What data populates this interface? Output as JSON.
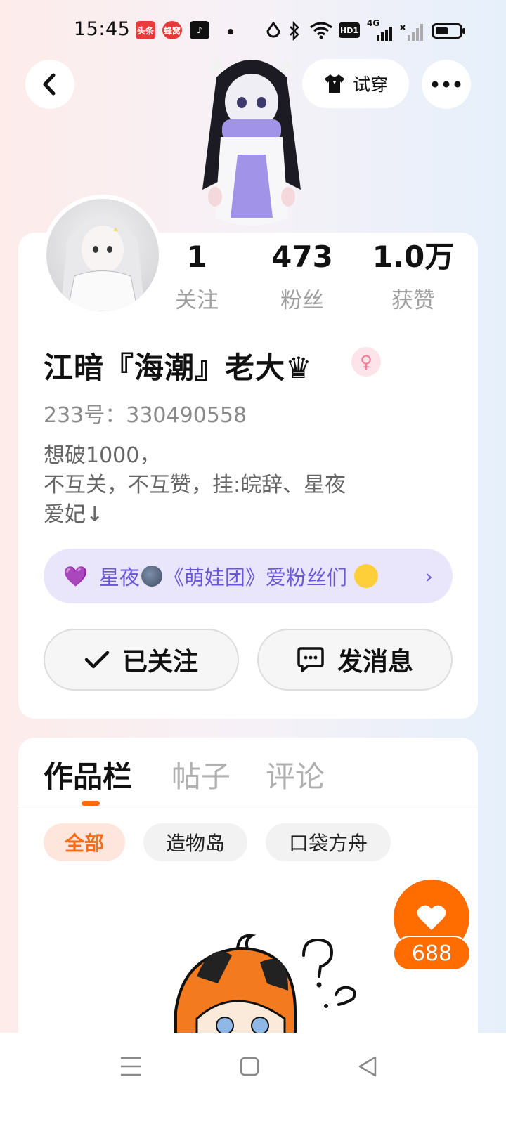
{
  "status_bar": {
    "time": "15:45",
    "app_icons": [
      "头条",
      "蜂窝",
      "♪"
    ],
    "network": "4G",
    "hd": "HD1"
  },
  "header": {
    "try_on_label": "试穿"
  },
  "profile": {
    "stats": [
      {
        "value": "1",
        "label": "关注"
      },
      {
        "value": "473",
        "label": "粉丝"
      },
      {
        "value": "1.0万",
        "label": "获赞"
      }
    ],
    "name": "江暗『海潮』老大♛",
    "uid": "233号：330490558",
    "bio_lines": [
      "想破1000，",
      "不互关，不互赞，挂:皖辞、星夜",
      "爱妃↓"
    ],
    "fan_group": {
      "prefix": "星夜",
      "suffix": "《萌娃团》爱粉丝们"
    },
    "follow_button": "已关注",
    "message_button": "发消息"
  },
  "content": {
    "tabs": [
      "作品栏",
      "帖子",
      "评论"
    ],
    "active_tab": "作品栏",
    "filter_chips": [
      "全部",
      "造物岛",
      "口袋方舟"
    ],
    "active_chip": "全部",
    "like_count": "688"
  },
  "colors": {
    "accent": "#ff6a13",
    "fan_purple": "#6b57d6",
    "fan_bg": "#e9e6fb"
  }
}
